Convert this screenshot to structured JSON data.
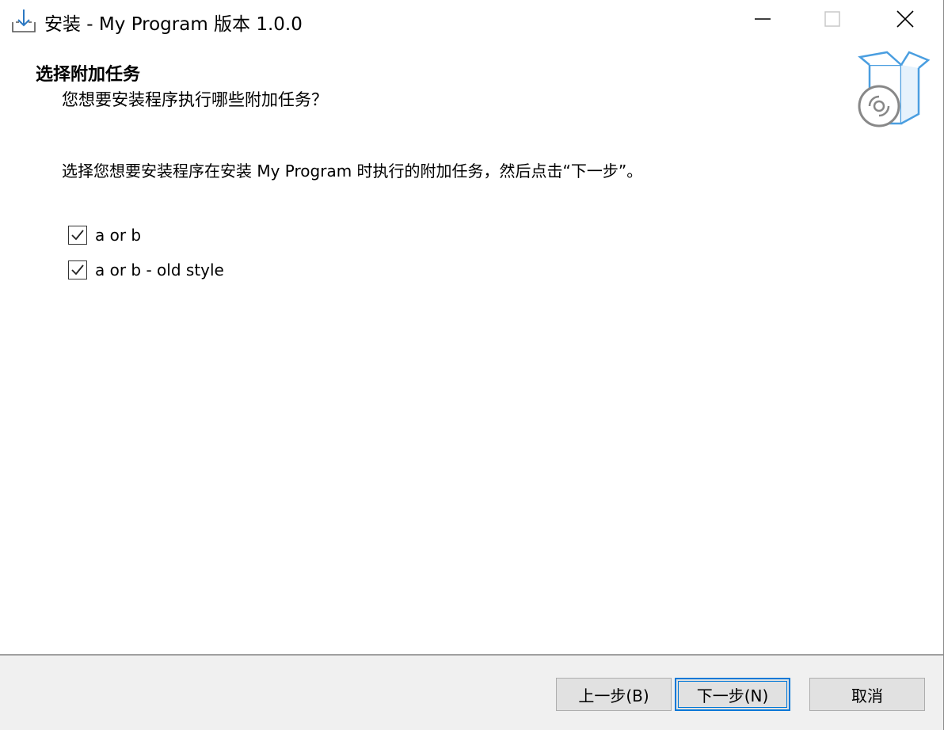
{
  "window": {
    "title": "安装 - My Program 版本 1.0.0",
    "controls": {
      "minimize_icon": "minimize-icon",
      "maximize_icon": "maximize-icon",
      "close_icon": "close-icon"
    }
  },
  "page": {
    "title": "选择附加任务",
    "subtitle": "您想要安装程序执行哪些附加任务？",
    "instructions": "选择您想要安装程序在安装 My Program 时执行的附加任务，然后点击“下一步”。"
  },
  "tasks": [
    {
      "label": "a or b",
      "checked": true
    },
    {
      "label": "a or b - old style",
      "checked": true
    }
  ],
  "buttons": {
    "back": "上一步(B)",
    "next": "下一步(N)",
    "cancel": "取消"
  },
  "colors": {
    "accent": "#0078d7",
    "footer_bg": "#f0f0f0",
    "icon_blue": "#4a9ee0"
  }
}
